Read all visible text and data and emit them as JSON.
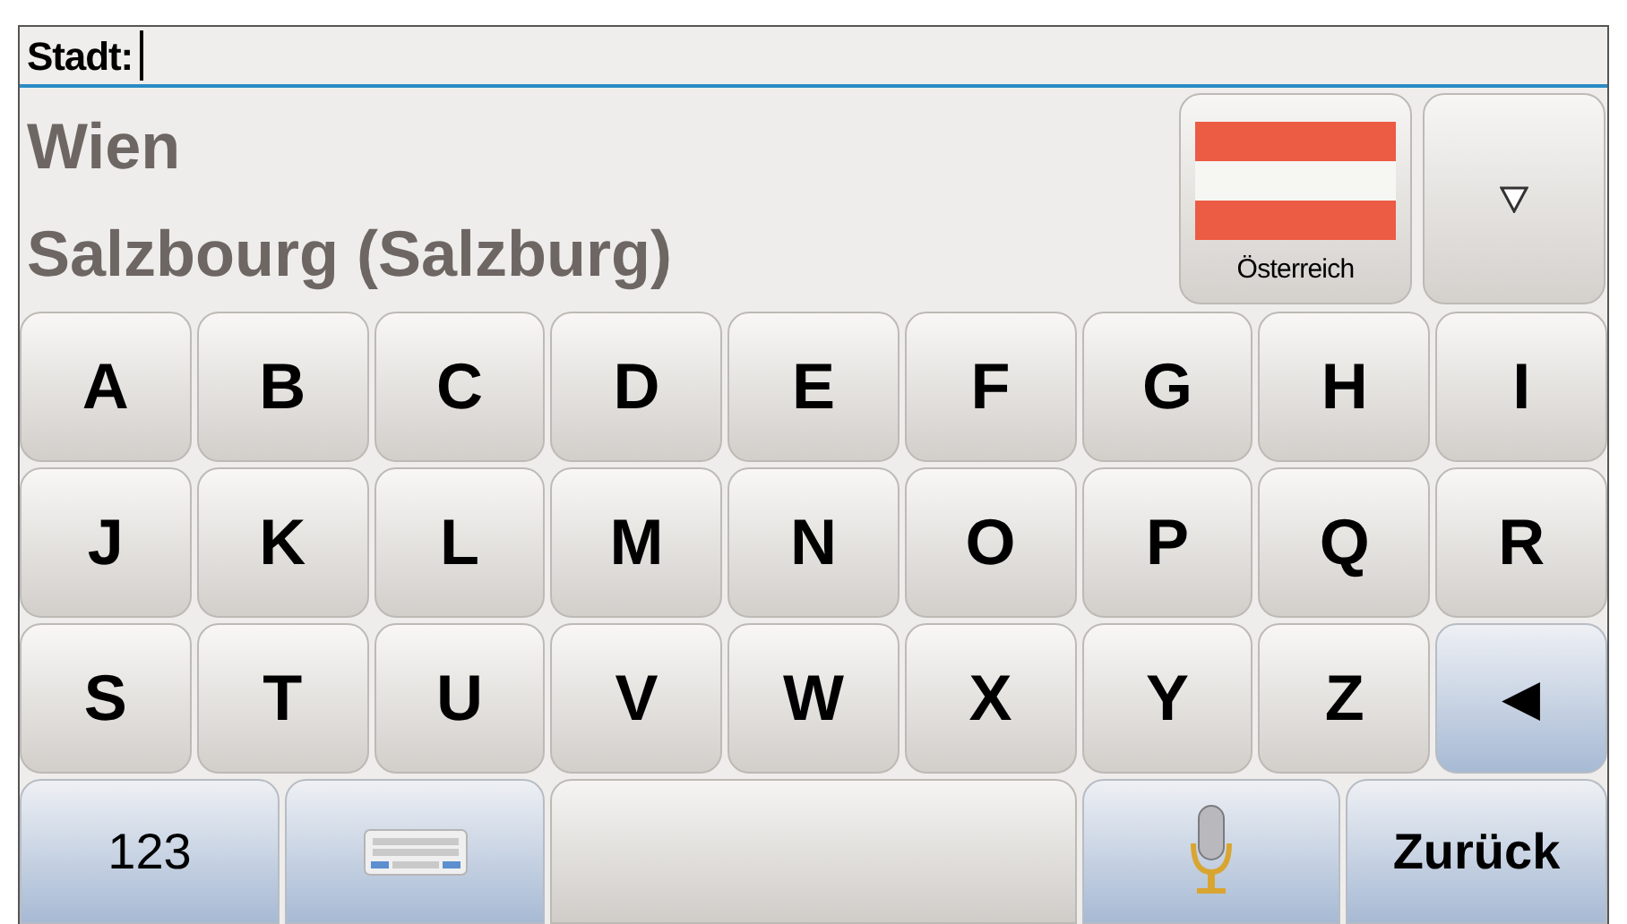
{
  "input": {
    "label": "Stadt:"
  },
  "suggestions": [
    "Wien",
    "Salzbourg (Salzburg)"
  ],
  "country_button": {
    "label": "Österreich"
  },
  "keys": [
    {
      "kind": "letter",
      "label": "A"
    },
    {
      "kind": "letter",
      "label": "B"
    },
    {
      "kind": "letter",
      "label": "C"
    },
    {
      "kind": "letter",
      "label": "D"
    },
    {
      "kind": "letter",
      "label": "E"
    },
    {
      "kind": "letter",
      "label": "F"
    },
    {
      "kind": "letter",
      "label": "G"
    },
    {
      "kind": "letter",
      "label": "H"
    },
    {
      "kind": "letter",
      "label": "I"
    },
    {
      "kind": "letter",
      "label": "J"
    },
    {
      "kind": "letter",
      "label": "K"
    },
    {
      "kind": "letter",
      "label": "L"
    },
    {
      "kind": "letter",
      "label": "M"
    },
    {
      "kind": "letter",
      "label": "N"
    },
    {
      "kind": "letter",
      "label": "O"
    },
    {
      "kind": "letter",
      "label": "P"
    },
    {
      "kind": "letter",
      "label": "Q"
    },
    {
      "kind": "letter",
      "label": "R"
    },
    {
      "kind": "letter",
      "label": "S"
    },
    {
      "kind": "letter",
      "label": "T"
    },
    {
      "kind": "letter",
      "label": "U"
    },
    {
      "kind": "letter",
      "label": "V"
    },
    {
      "kind": "letter",
      "label": "W"
    },
    {
      "kind": "letter",
      "label": "X"
    },
    {
      "kind": "letter",
      "label": "Y"
    },
    {
      "kind": "letter",
      "label": "Z"
    },
    {
      "kind": "backspace",
      "label": "◀"
    }
  ],
  "bottom_row": [
    {
      "kind": "text",
      "label": "123"
    },
    {
      "kind": "keyboard"
    },
    {
      "kind": "space"
    },
    {
      "kind": "microphone"
    },
    {
      "kind": "text",
      "label": "Zurück"
    }
  ]
}
